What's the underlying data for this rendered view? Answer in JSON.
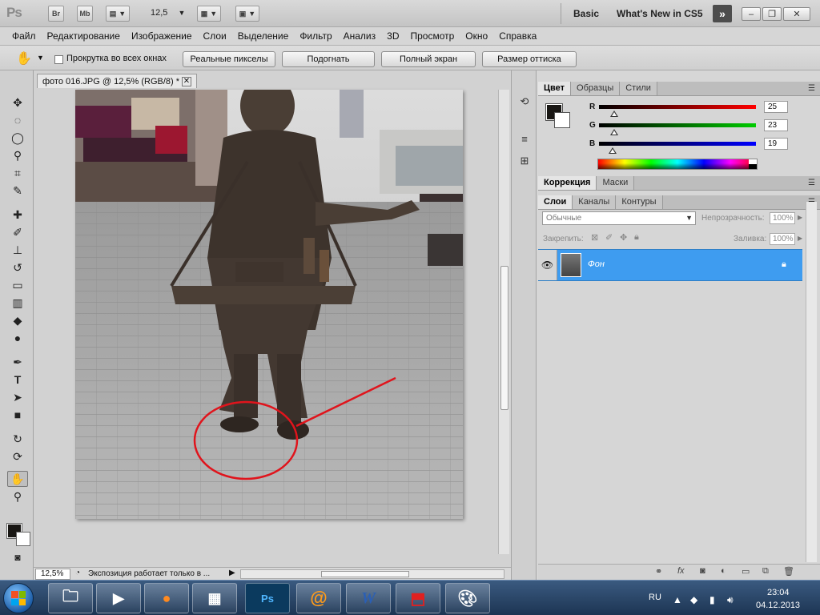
{
  "app": {
    "logo": "Ps",
    "bridge_label": "Br",
    "minibridge_label": "Mb",
    "zoom_value": "12,5",
    "workspace_basic": "Basic",
    "workspace_new": "What's New in CS5"
  },
  "menu": [
    "Файл",
    "Редактирование",
    "Изображение",
    "Слои",
    "Выделение",
    "Фильтр",
    "Анализ",
    "3D",
    "Просмотр",
    "Окно",
    "Справка"
  ],
  "options": {
    "scroll_all_label": "Прокрутка во всех окнах",
    "actual_pixels": "Реальные пикселы",
    "fit_screen": "Подогнать",
    "full_screen": "Полный экран",
    "print_size": "Размер оттиска"
  },
  "document": {
    "tab_title": "фото 016.JPG @ 12,5% (RGB/8) *",
    "zoom": "12,5%",
    "status": "Экспозиция работает только в ..."
  },
  "color_panel": {
    "tabs": [
      "Цвет",
      "Образцы",
      "Стили"
    ],
    "r_label": "R",
    "g_label": "G",
    "b_label": "B",
    "r": "25",
    "g": "23",
    "b": "19",
    "fg_color": "#191714"
  },
  "adjust_panel": {
    "tabs": [
      "Коррекция",
      "Маски"
    ]
  },
  "layers_panel": {
    "tabs": [
      "Слои",
      "Каналы",
      "Контуры"
    ],
    "blend_mode": "Обычные",
    "opacity_label": "Непрозрачность:",
    "opacity": "100%",
    "lock_label": "Закрепить:",
    "fill_label": "Заливка:",
    "fill": "100%",
    "layers": [
      {
        "name": "Фон",
        "locked": true,
        "selected": true
      }
    ]
  },
  "taskbar": {
    "lang": "RU",
    "time": "23:04",
    "date": "04.12.2013",
    "apps": [
      "explorer",
      "media-player",
      "firefox",
      "video-editor",
      "photoshop",
      "mail-agent",
      "word",
      "acrobat",
      "paint"
    ]
  },
  "colors": {
    "accent_layer": "#3e9cf0",
    "annotation_red": "#e0141c"
  }
}
